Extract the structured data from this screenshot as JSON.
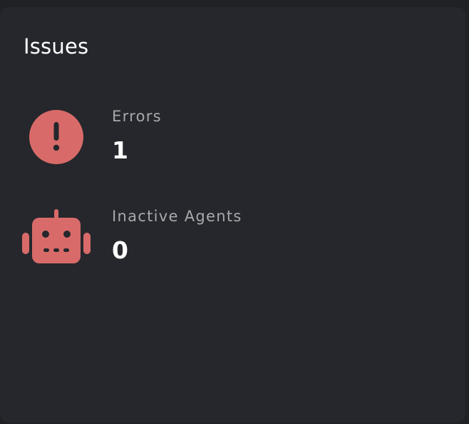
{
  "card": {
    "title": "Issues"
  },
  "issues": [
    {
      "label": "Errors",
      "value": "1",
      "icon": "exclamation-circle-icon"
    },
    {
      "label": "Inactive Agents",
      "value": "0",
      "icon": "robot-icon"
    }
  ],
  "colors": {
    "accent": "#d86b69",
    "card_background": "#25272c",
    "page_background": "#1f2125",
    "label_text": "#a7a9ad",
    "value_text": "#ffffff"
  }
}
